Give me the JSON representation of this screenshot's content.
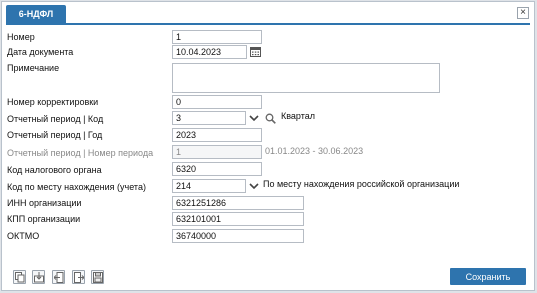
{
  "tab": {
    "title": "6-НДФЛ"
  },
  "header": {
    "close_icon": "×"
  },
  "form": {
    "number": {
      "label": "Номер",
      "value": "1"
    },
    "doc_date": {
      "label": "Дата документа",
      "value": "10.04.2023"
    },
    "note": {
      "label": "Примечание",
      "value": ""
    },
    "correction_number": {
      "label": "Номер корректировки",
      "value": "0"
    },
    "period_code": {
      "label": "Отчетный период | Код",
      "value": "3",
      "hint": "Квартал"
    },
    "period_year": {
      "label": "Отчетный период | Год",
      "value": "2023"
    },
    "period_number": {
      "label": "Отчетный период | Номер периода",
      "value": "1",
      "range": "01.01.2023 - 30.06.2023"
    },
    "tax_authority_code": {
      "label": "Код налогового органа",
      "value": "6320"
    },
    "location_code": {
      "label": "Код по месту нахождения (учета)",
      "value": "214",
      "hint": "По месту нахождения российской организации"
    },
    "inn": {
      "label": "ИНН организации",
      "value": "6321251286"
    },
    "kpp": {
      "label": "КПП организации",
      "value": "632101001"
    },
    "oktmo": {
      "label": "ОКТМО",
      "value": "36740000"
    }
  },
  "footer": {
    "save_label": "Сохранить"
  },
  "icons": [
    "copy-icon",
    "import-icon",
    "export-left-icon",
    "export-right-icon",
    "save-disk-icon",
    "calendar-icon",
    "chevron-down-icon",
    "search-icon",
    "close-icon"
  ],
  "colors": {
    "accent": "#2e74ae",
    "border": "#b6bcc4",
    "muted_text": "#888888"
  }
}
